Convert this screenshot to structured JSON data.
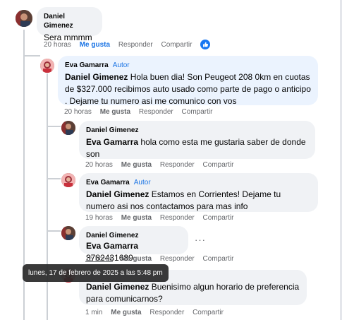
{
  "comments": [
    {
      "author": "Daniel Gimenez",
      "badge": "",
      "mention": "",
      "text": "Sera mmmm",
      "time": "20 horas",
      "like": "Me gusta",
      "reply": "Responder",
      "share": "Compartir"
    },
    {
      "author": "Eva Gamarra",
      "badge": "Autor",
      "mention": "Daniel Gimenez",
      "text": " Hola buen dia! Son Peugeot 208 0km en cuotas de $327.000 recibimos auto usado como parte de pago o anticipo . Dejame tu numero asi me comunico con vos",
      "time": "20 horas",
      "like": "Me gusta",
      "reply": "Responder",
      "share": "Compartir"
    },
    {
      "author": "Daniel Gimenez",
      "badge": "",
      "mention": "Eva Gamarra",
      "text": " hola como esta me gustaria saber de donde son",
      "time": "20 horas",
      "like": "Me gusta",
      "reply": "Responder",
      "share": "Compartir"
    },
    {
      "author": "Eva Gamarra",
      "badge": "Autor",
      "mention": "Daniel Gimenez",
      "text": " Estamos en Corrientes! Dejame tu numero asi nos contactamos para mas info",
      "time": "19 horas",
      "like": "Me gusta",
      "reply": "Responder",
      "share": "Compartir"
    },
    {
      "author": "Daniel Gimenez",
      "badge": "",
      "mention": "Eva Gamarra",
      "text": " 3782431689",
      "time": "15 horas",
      "like": "Me gusta",
      "reply": "Responder",
      "share": "Compartir"
    },
    {
      "author": "",
      "badge": "",
      "mention": "Daniel Gimenez",
      "text": " Buenisimo algun horario de preferencia para comunicarnos?",
      "time": "1 min",
      "like": "Me gusta",
      "reply": "Responder",
      "share": "Compartir"
    }
  ],
  "tooltip": "lunes, 17 de febrero de 2025 a las 5:48 pm",
  "more_menu": "···",
  "colors": {
    "accent": "#1877f2",
    "author_bubble": "#ebf3fe",
    "bubble": "#f0f2f5"
  },
  "icons": {
    "reaction": "like-thumb-icon",
    "more": "more-options-icon"
  }
}
